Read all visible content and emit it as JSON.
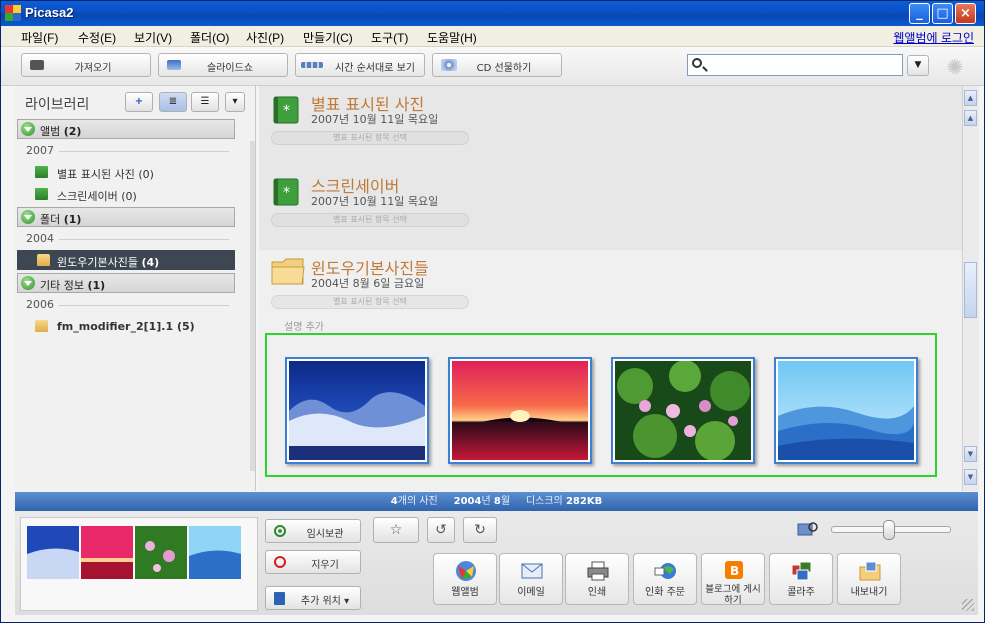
{
  "window": {
    "title": "Picasa2",
    "minimize": "_",
    "maximize": "□",
    "close": "×"
  },
  "menu": {
    "items": [
      "파일(F)",
      "수정(E)",
      "보기(V)",
      "폴더(O)",
      "사진(P)",
      "만들기(C)",
      "도구(T)",
      "도움말(H)"
    ],
    "login_link": "웹앨범에 로그인"
  },
  "toolbar": {
    "import_label": "가져오기",
    "slideshow_label": "슬라이드쇼",
    "timeline_label": "시간 순서대로 보기",
    "cd_label": "CD 선물하기",
    "search_value": "",
    "dropdown_glyph": "▼",
    "spinner_glyph": "✺"
  },
  "library": {
    "title": "라이브러리",
    "add_btn": "+",
    "view_list_btn": "≣",
    "view_tree_btn": "☰",
    "menu_btn": "▾",
    "sections": [
      {
        "label": "앨범",
        "count": "(2)"
      },
      {
        "label": "폴더",
        "count": "(1)"
      },
      {
        "label": "기타 정보",
        "count": "(1)"
      }
    ],
    "years": [
      "2007",
      "2004",
      "2006"
    ],
    "items": [
      {
        "label": "별표 표시된 사진 (0)"
      },
      {
        "label": "스크린세이버 (0)"
      },
      {
        "label": "윈도우기본사진들",
        "count": "(4)"
      },
      {
        "label": "fm_modifier_2[1].1",
        "count": "(5)"
      }
    ]
  },
  "main": {
    "albums": [
      {
        "title": "별표 표시된 사진",
        "date": "2007년 10월 11일 목요일",
        "select_label": "별표 표시된 항목 선택"
      },
      {
        "title": "스크린세이버",
        "date": "2007년 10월 11일 목요일",
        "select_label": "별표 표시된 항목 선택"
      }
    ],
    "folder": {
      "title": "윈도우기본사진들",
      "date": "2004년 8월 6일 금요일",
      "select_label": "별표 표시된 항목 선택",
      "add_description": "설명 추가"
    },
    "photos": [
      "winter",
      "sunset",
      "water-lilies",
      "blue-hills"
    ]
  },
  "statusbar": {
    "count_num": "4",
    "count_label": "개의 사진",
    "year": "2004",
    "year_suffix": "년",
    "month": "8",
    "month_suffix": "월",
    "disk_label": "디스크의",
    "disk_size": "282KB"
  },
  "tray": {
    "hold_label": "임시보관",
    "clear_label": "지우기",
    "add_to_label": "추가 위치",
    "star_glyph": "☆",
    "rotate_left_glyph": "↺",
    "rotate_right_glyph": "↻"
  },
  "actions": [
    {
      "icon": "web-album-icon",
      "label": "웹앨범"
    },
    {
      "icon": "email-icon",
      "label": "이메일"
    },
    {
      "icon": "print-icon",
      "label": "인쇄"
    },
    {
      "icon": "order-prints-icon",
      "label": "인화 주문"
    },
    {
      "icon": "blogger-icon",
      "label": "블로그에 게시하기"
    },
    {
      "icon": "collage-icon",
      "label": "콜라주"
    },
    {
      "icon": "export-icon",
      "label": "내보내기"
    }
  ],
  "colors": {
    "title_bar": "#0b58d0",
    "album_title": "#c07a38",
    "selection_border": "#2cd42c",
    "status_bar": "#2f64ad"
  }
}
